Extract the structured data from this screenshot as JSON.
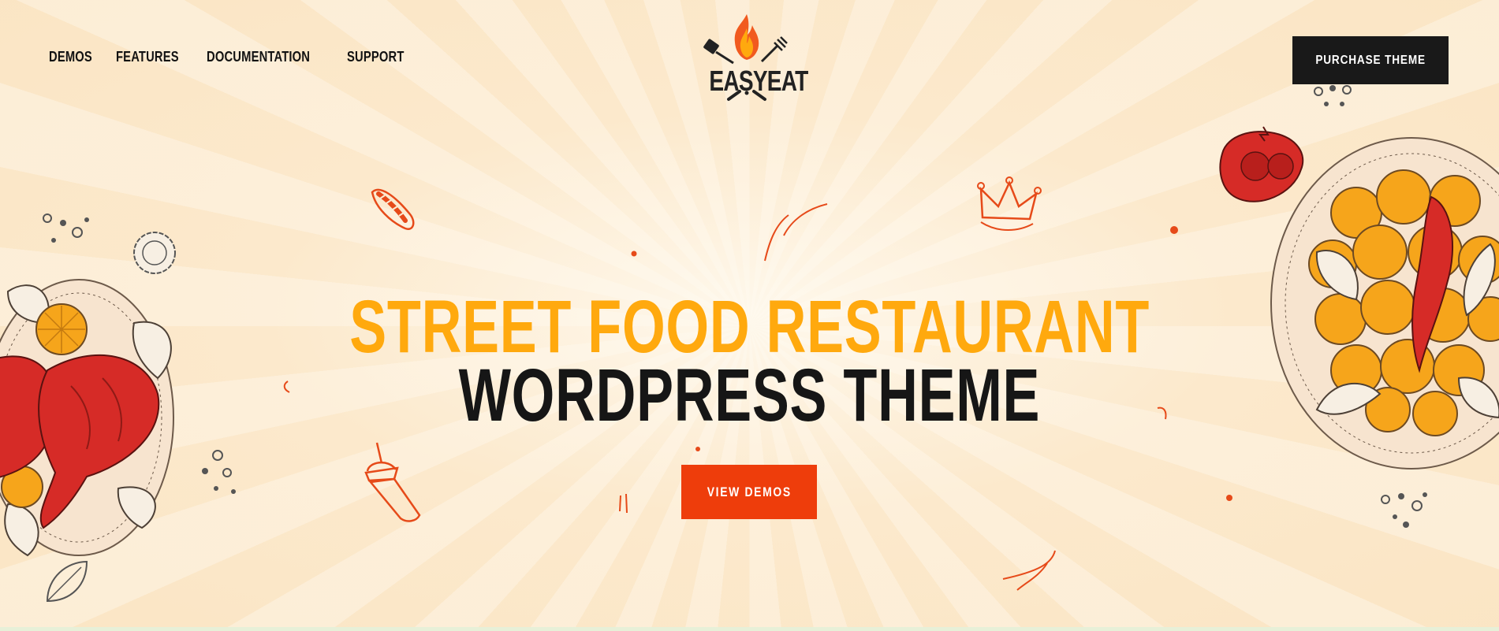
{
  "nav": {
    "items": [
      {
        "label": "DEMOS"
      },
      {
        "label": "FEATURES"
      },
      {
        "label": "DOCUMENTATION"
      },
      {
        "label": "SUPPORT"
      }
    ]
  },
  "logo": {
    "text": "EASYEAT"
  },
  "header": {
    "purchase_label": "PURCHASE THEME"
  },
  "hero": {
    "headline_line1": "STREET FOOD RESTAURANT",
    "headline_line2": "WORDPRESS THEME",
    "cta_label": "VIEW DEMOS"
  },
  "colors": {
    "accent_yellow": "#ffa90e",
    "accent_red": "#ee3d0b",
    "dark": "#191919",
    "background": "#fcecd2"
  },
  "icons": [
    "flame-icon",
    "spatula-icon",
    "fork-icon",
    "hotdog-icon",
    "crown-icon",
    "drink-cup-icon",
    "tomato-icon",
    "chicken-plate-illustration",
    "nuggets-plate-illustration",
    "leaf-icon"
  ]
}
